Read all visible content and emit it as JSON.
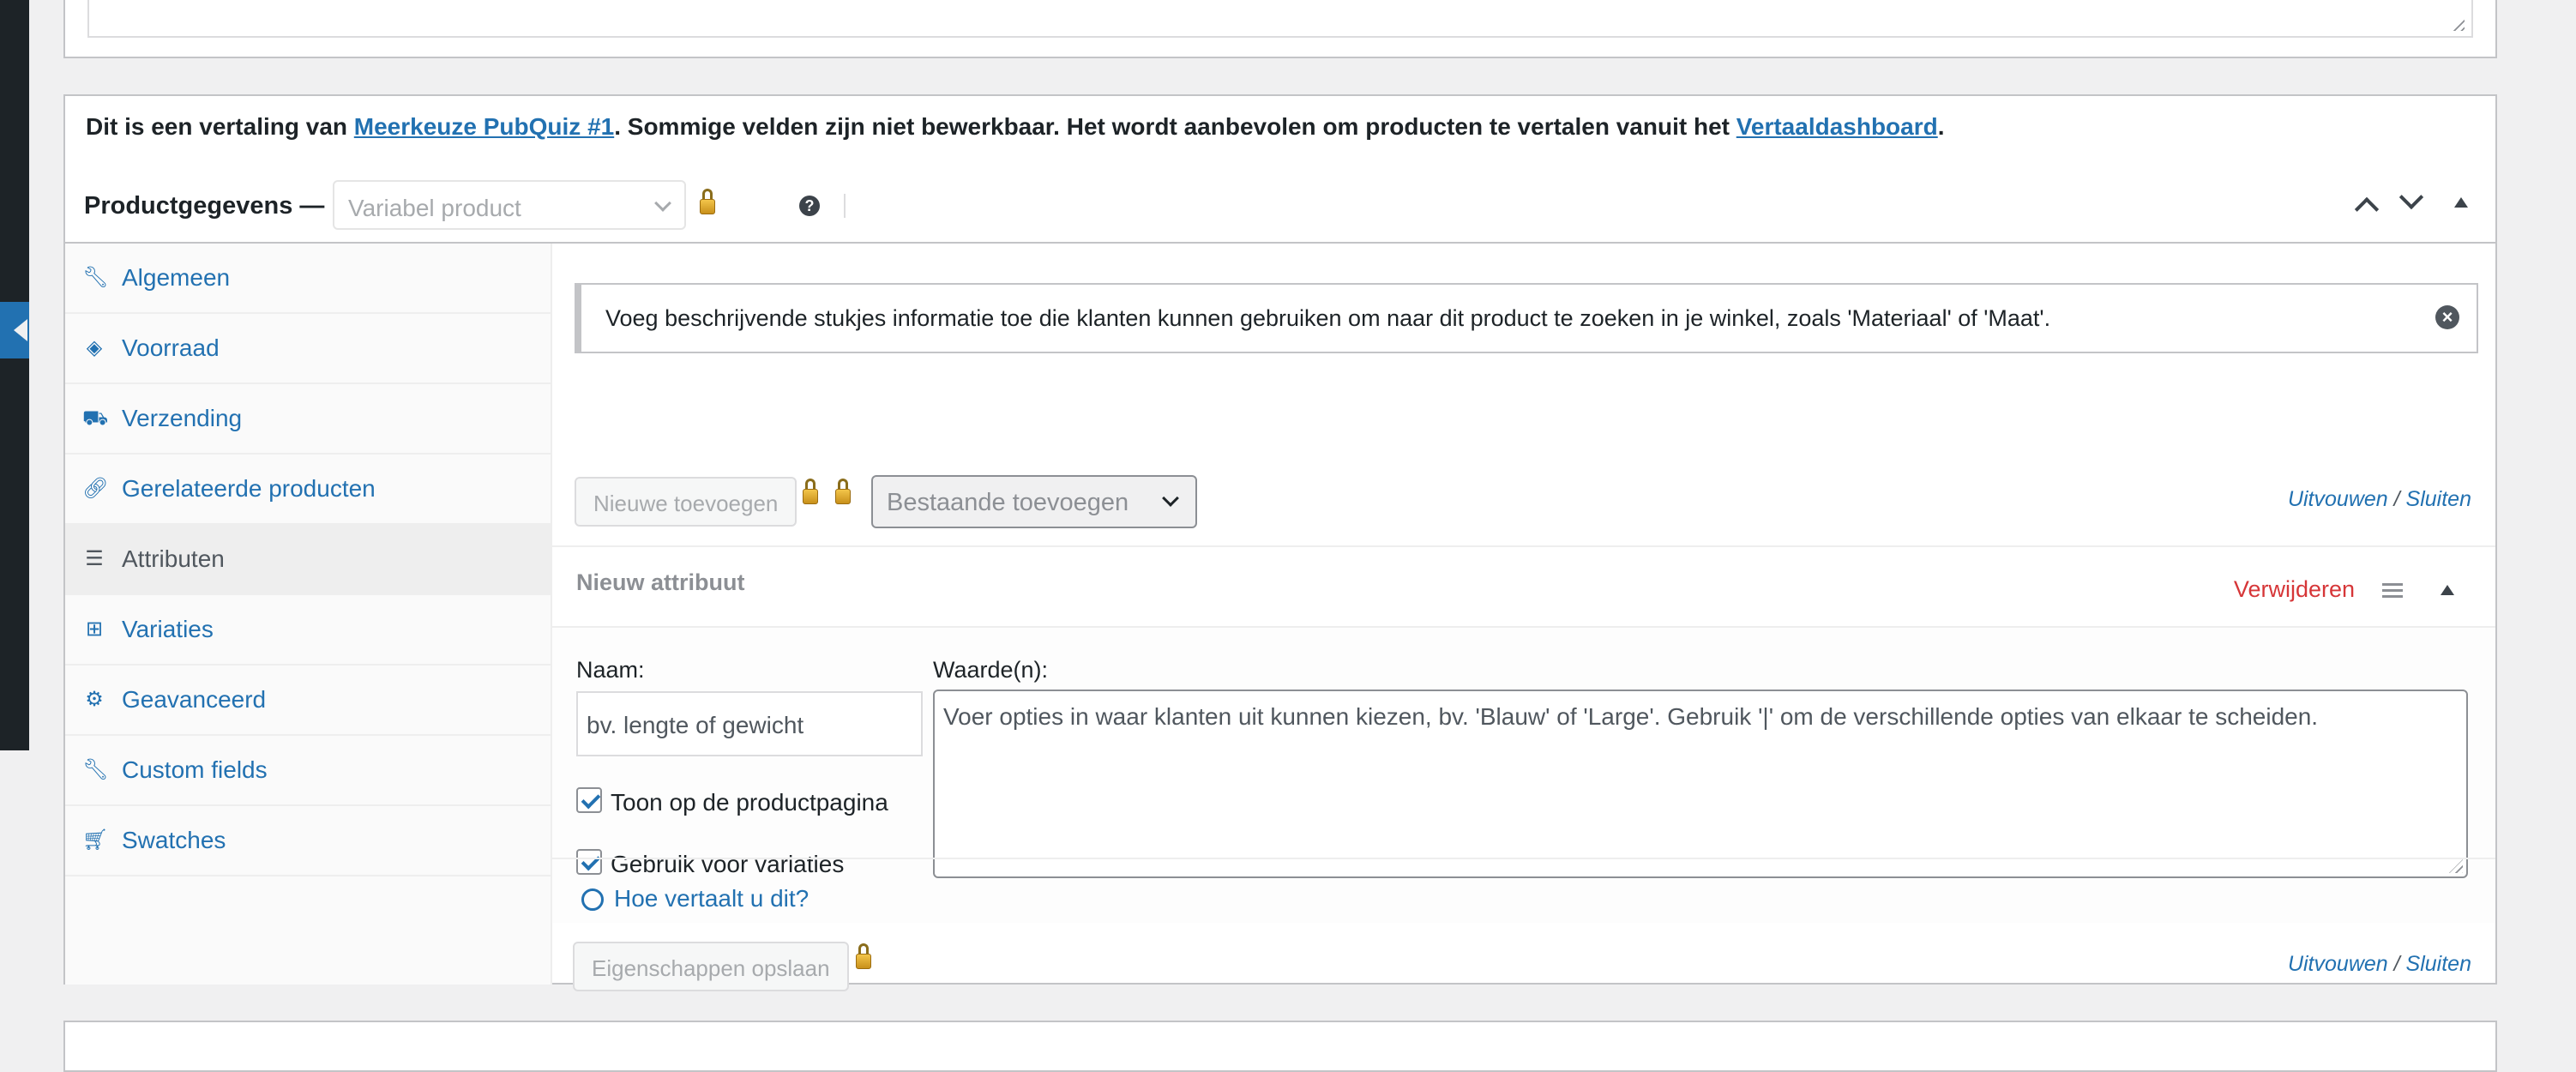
{
  "notice": {
    "prefix": "Dit is een vertaling van ",
    "source_link": "Meerkeuze PubQuiz #1",
    "middle": ". Sommige velden zijn niet bewerkbaar. Het wordt aanbevolen om producten te vertalen vanuit het ",
    "dashboard_link": "Vertaaldashboard",
    "suffix": "."
  },
  "product_data": {
    "label": "Productgegevens —",
    "type_value": "Variabel product"
  },
  "sidebar": {
    "items": [
      {
        "label": "Algemeen",
        "icon": "wrench-icon"
      },
      {
        "label": "Voorraad",
        "icon": "tag-icon"
      },
      {
        "label": "Verzending",
        "icon": "truck-icon"
      },
      {
        "label": "Gerelateerde producten",
        "icon": "link-icon"
      },
      {
        "label": "Attributen",
        "icon": "list-icon",
        "active": true
      },
      {
        "label": "Variaties",
        "icon": "grid-icon"
      },
      {
        "label": "Geavanceerd",
        "icon": "gear-icon"
      },
      {
        "label": "Custom fields",
        "icon": "wrench-icon"
      },
      {
        "label": "Swatches",
        "icon": "cart-icon"
      }
    ]
  },
  "attributes": {
    "info": "Voeg beschrijvende stukjes informatie toe die klanten kunnen gebruiken om naar dit product te zoeken in je winkel, zoals 'Materiaal' of 'Maat'.",
    "add_new_button": "Nieuwe toevoegen",
    "existing_select": "Bestaande toevoegen",
    "expand_label": "Uitvouwen",
    "slash": "/",
    "close_label": "Sluiten",
    "new_attribute_title": "Nieuw attribuut",
    "remove_label": "Verwijderen",
    "name_label": "Naam:",
    "name_placeholder": "bv. lengte of gewicht",
    "values_label": "Waarde(n):",
    "values_placeholder": "Voer opties in waar klanten uit kunnen kiezen, bv. 'Blauw' of 'Large'. Gebruik '|' om de verschillende opties van elkaar te scheiden.",
    "visible_checkbox_label": "Toon op de productpagina",
    "variations_checkbox_label": "Gebruik voor variaties",
    "save_button": "Eigenschappen opslaan",
    "help_link": "Hoe vertaalt u dit?"
  }
}
